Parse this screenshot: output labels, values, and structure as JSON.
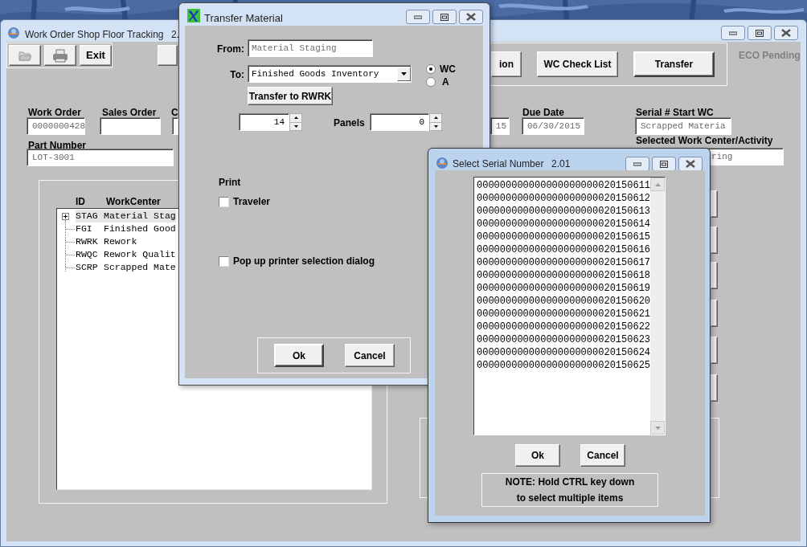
{
  "main_window": {
    "title": "Work Order Shop Floor Tracking",
    "version": "2.",
    "toolbar": [
      {
        "kind": "open"
      },
      {
        "kind": "print"
      },
      {
        "kind": "text",
        "label": "Exit"
      }
    ],
    "buttons": [
      {
        "label": "ion"
      },
      {
        "label": "WC Check List"
      },
      {
        "label": "Transfer"
      }
    ],
    "eco_status": "ECO Pending",
    "fields": [
      {
        "label": "Work Order",
        "value": "0000000428"
      },
      {
        "label": "Sales Order"
      },
      {
        "label": "C"
      },
      {
        "value": "15"
      },
      {
        "label": "Due Date",
        "value": "06/30/2015"
      },
      {
        "label": "Serial # Start WC",
        "value": "Scrapped Materia"
      },
      {
        "label": "Part Number",
        "value": "LOT-3001"
      },
      {
        "label": "Selected Work Center/Activity",
        "value": "ring"
      }
    ],
    "tree": {
      "columns": [
        "ID",
        "WorkCenter"
      ],
      "rows": [
        {
          "id": "STAG",
          "name": "Material Stag",
          "selected": true,
          "expandable": true
        },
        {
          "id": "FGI",
          "name": "Finished Good",
          "selected": false,
          "expandable": false
        },
        {
          "id": "RWRK",
          "name": "Rework",
          "selected": false,
          "expandable": false
        },
        {
          "id": "RWQC",
          "name": "Rework Qualit",
          "selected": false,
          "expandable": false
        },
        {
          "id": "SCRP",
          "name": "Scrapped Mate",
          "selected": false,
          "expandable": false
        }
      ]
    }
  },
  "transfer_dialog": {
    "title": "Transfer Material",
    "from_label": "From:",
    "from_value": "Material Staging",
    "to_label": "To:",
    "to_value": "Finished Goods Inventory",
    "transfer_button": "Transfer to RWRK",
    "destination": [
      {
        "label": "WC",
        "selected": true
      },
      {
        "label": "A",
        "selected": false
      }
    ],
    "quantity": "14",
    "panels_label": "Panels",
    "panels": "0",
    "print_label": "Print",
    "checkboxes": [
      {
        "label": "Traveler",
        "checked": false
      },
      {
        "label": "Pop up printer selection dialog",
        "checked": false
      }
    ],
    "buttons": [
      "Ok",
      "Cancel"
    ]
  },
  "serial_dialog": {
    "title": "Select Serial Number",
    "version": "2.01",
    "serials": [
      {
        "value": "000000000000000000000020150611",
        "selected": false
      },
      {
        "value": "000000000000000000000020150612",
        "selected": false
      },
      {
        "value": "000000000000000000000020150613",
        "selected": false
      },
      {
        "value": "000000000000000000000020150614",
        "selected": false
      },
      {
        "value": "000000000000000000000020150615",
        "selected": false
      },
      {
        "value": "000000000000000000000020150616",
        "selected": false
      },
      {
        "value": "000000000000000000000020150617",
        "selected": false
      },
      {
        "value": "000000000000000000000020150618",
        "selected": false
      },
      {
        "value": "000000000000000000000020150619",
        "selected": false
      },
      {
        "value": "000000000000000000000020150620",
        "selected": false
      },
      {
        "value": "000000000000000000000020150621",
        "selected": false
      },
      {
        "value": "000000000000000000000020150622",
        "selected": false
      },
      {
        "value": "000000000000000000000020150623",
        "selected": false
      },
      {
        "value": "000000000000000000000020150624",
        "selected": false
      },
      {
        "value": "000000000000000000000020150625",
        "selected": false
      }
    ],
    "buttons": [
      "Ok",
      "Cancel"
    ],
    "note": [
      "NOTE: Hold CTRL key down",
      "to select multiple items"
    ]
  }
}
